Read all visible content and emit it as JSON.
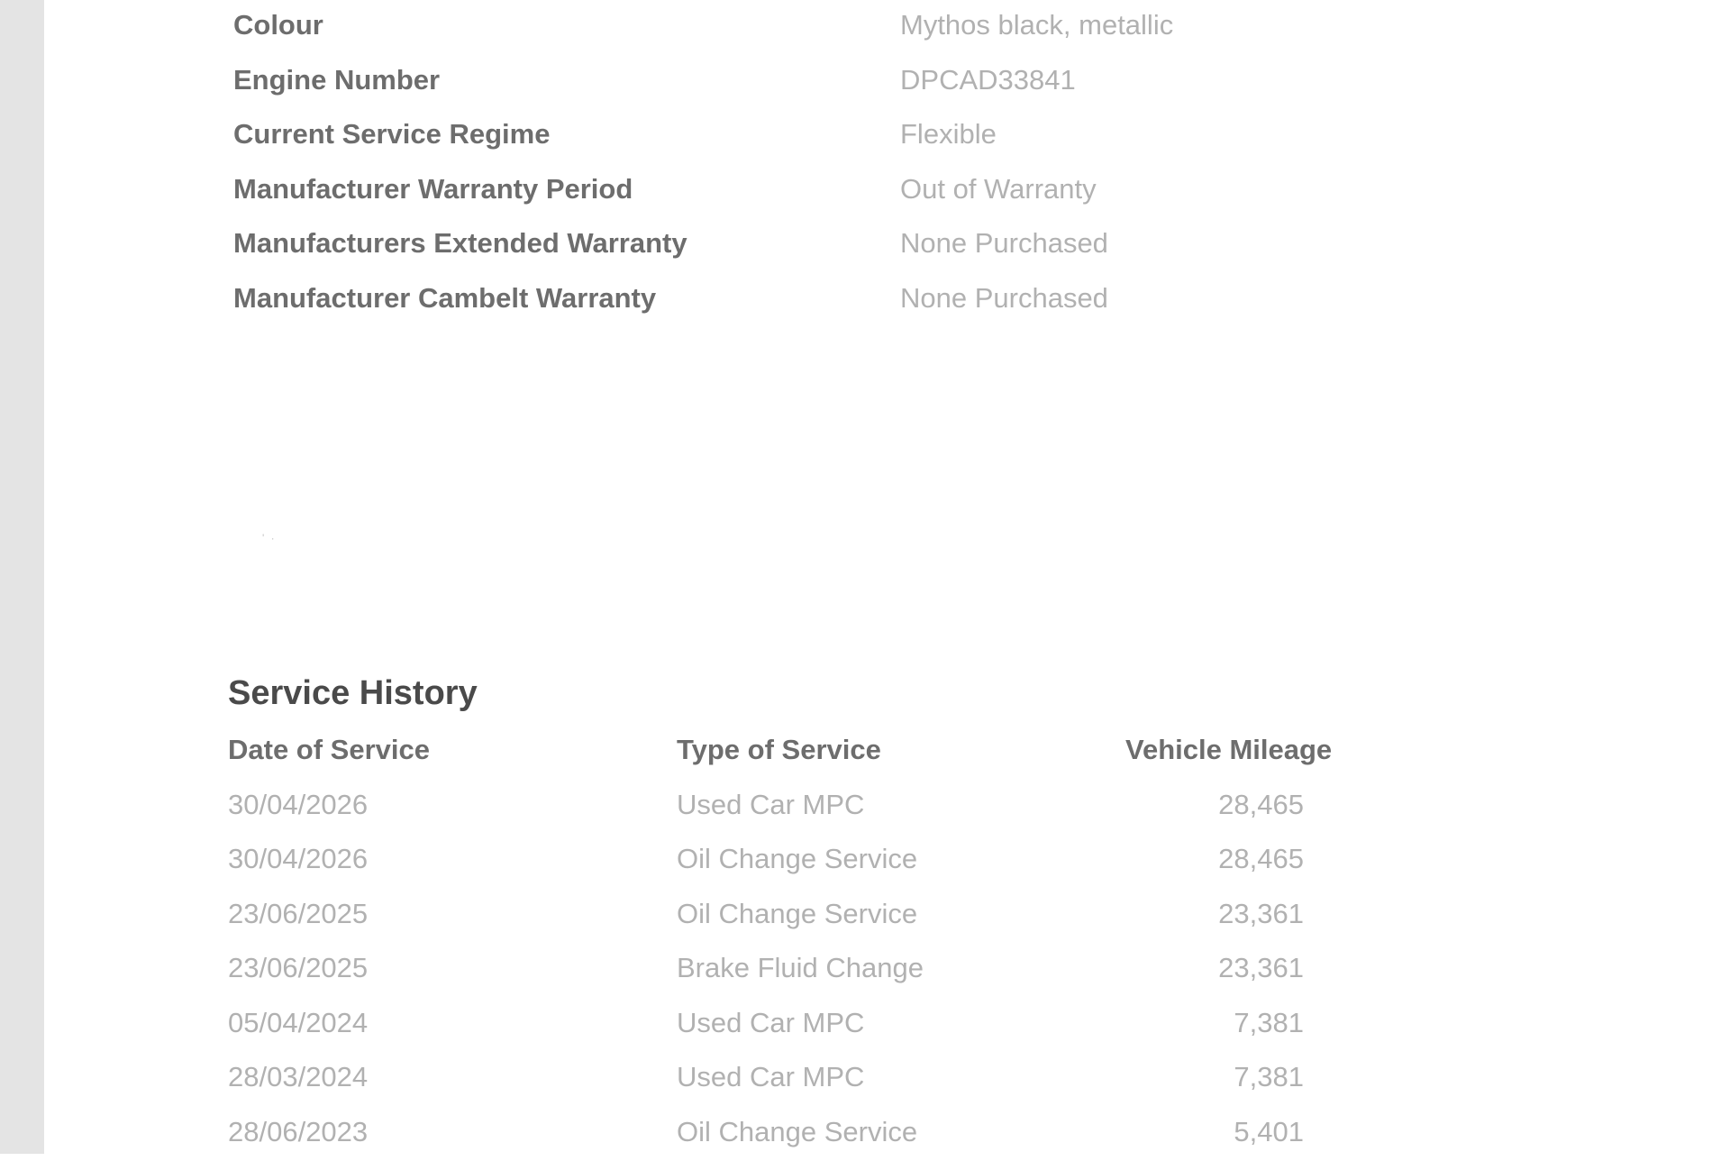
{
  "vehicle_details": [
    {
      "label": "Colour",
      "value": "Mythos black, metallic"
    },
    {
      "label": "Engine Number",
      "value": "DPCAD33841"
    },
    {
      "label": "Current Service Regime",
      "value": "Flexible"
    },
    {
      "label": "Manufacturer Warranty Period",
      "value": "Out of Warranty"
    },
    {
      "label": "Manufacturers Extended Warranty",
      "value": "None Purchased"
    },
    {
      "label": "Manufacturer Cambelt Warranty",
      "value": "None Purchased"
    }
  ],
  "service_history": {
    "title": "Service History",
    "headers": {
      "date": "Date of Service",
      "type": "Type of Service",
      "mileage": "Vehicle Mileage"
    },
    "rows": [
      {
        "date": "30/04/2026",
        "type": "Used Car MPC",
        "mileage": "28,465"
      },
      {
        "date": "30/04/2026",
        "type": "Oil Change Service",
        "mileage": "28,465"
      },
      {
        "date": "23/06/2025",
        "type": "Oil Change Service",
        "mileage": "23,361"
      },
      {
        "date": "23/06/2025",
        "type": "Brake Fluid Change",
        "mileage": "23,361"
      },
      {
        "date": "05/04/2024",
        "type": "Used Car MPC",
        "mileage": "7,381"
      },
      {
        "date": "28/03/2024",
        "type": "Used Car MPC",
        "mileage": "7,381"
      },
      {
        "date": "28/06/2023",
        "type": "Oil Change Service",
        "mileage": "5,401"
      }
    ]
  }
}
